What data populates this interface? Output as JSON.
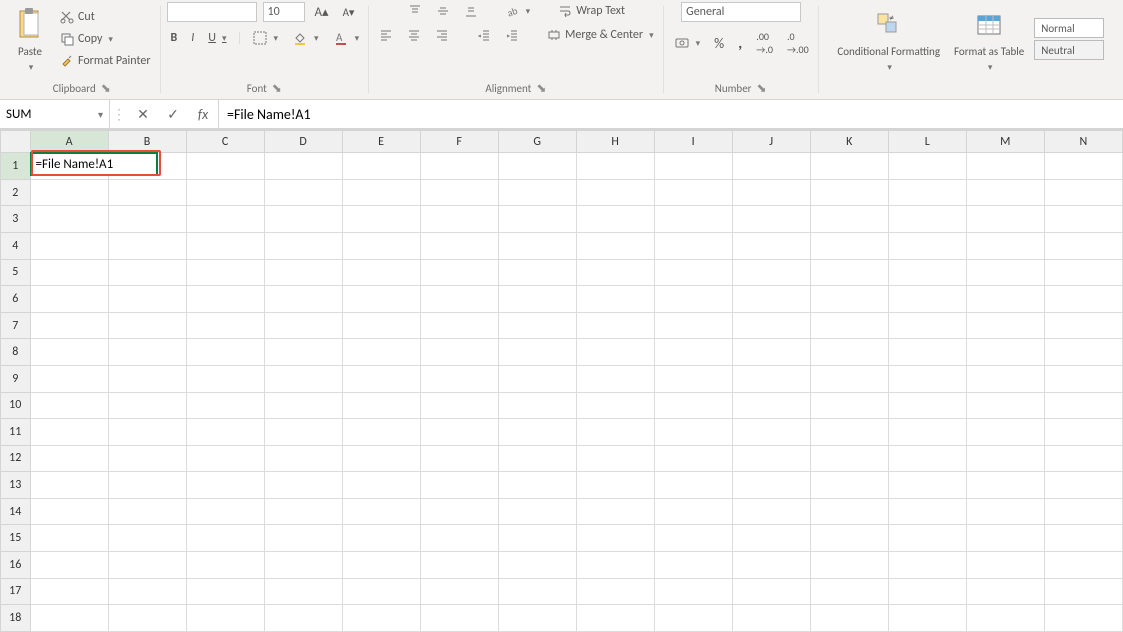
{
  "ribbon": {
    "clipboard": {
      "paste": "Paste",
      "cut": "Cut",
      "copy": "Copy",
      "format_painter": "Format Painter",
      "label": "Clipboard"
    },
    "font": {
      "name": "",
      "size": "10",
      "label": "Font"
    },
    "alignment": {
      "wrap_text": "Wrap Text",
      "merge_center": "Merge & Center",
      "label": "Alignment"
    },
    "number": {
      "format": "General",
      "label": "Number"
    },
    "styles": {
      "conditional": "Conditional Formatting",
      "format_table": "Format as Table",
      "normal": "Normal",
      "neutral": "Neutral"
    }
  },
  "formula_bar": {
    "name_box": "SUM",
    "formula": "=File Name!A1"
  },
  "grid": {
    "columns": [
      "A",
      "B",
      "C",
      "D",
      "E",
      "F",
      "G",
      "H",
      "I",
      "J",
      "K",
      "L",
      "M",
      "N"
    ],
    "rows": [
      1,
      2,
      3,
      4,
      5,
      6,
      7,
      8,
      9,
      10,
      11,
      12,
      13,
      14,
      15,
      16,
      17,
      18
    ],
    "active_row": 1,
    "active_col": "A",
    "active_value": "=File Name!A1"
  }
}
